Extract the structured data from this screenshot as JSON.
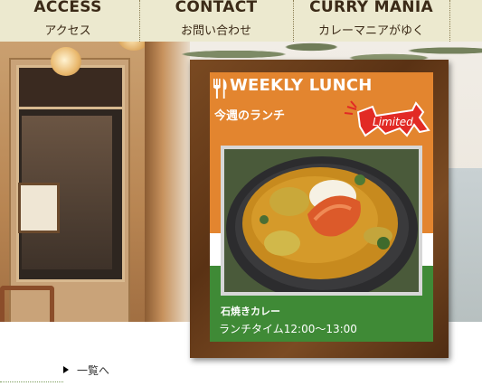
{
  "nav": {
    "items": [
      {
        "en": "ACCESS",
        "jp": "アクセス"
      },
      {
        "en": "CONTACT",
        "jp": "お問い合わせ"
      },
      {
        "en": "CURRY MANIA",
        "jp": "カレーマニアがゆく"
      }
    ]
  },
  "board": {
    "title": "WEEKLY LUNCH",
    "subtitle": "今週のランチ",
    "badge": "Limited",
    "dish_name": "石焼きカレー",
    "dish_time": "ランチタイム12:00～13:00",
    "icon": "fork-knife-icon",
    "colors": {
      "orange": "#e3852f",
      "white": "#ffffff",
      "green": "#3f8a36",
      "frame": "#5a3214"
    }
  },
  "footer": {
    "list_link": "一覧へ"
  }
}
